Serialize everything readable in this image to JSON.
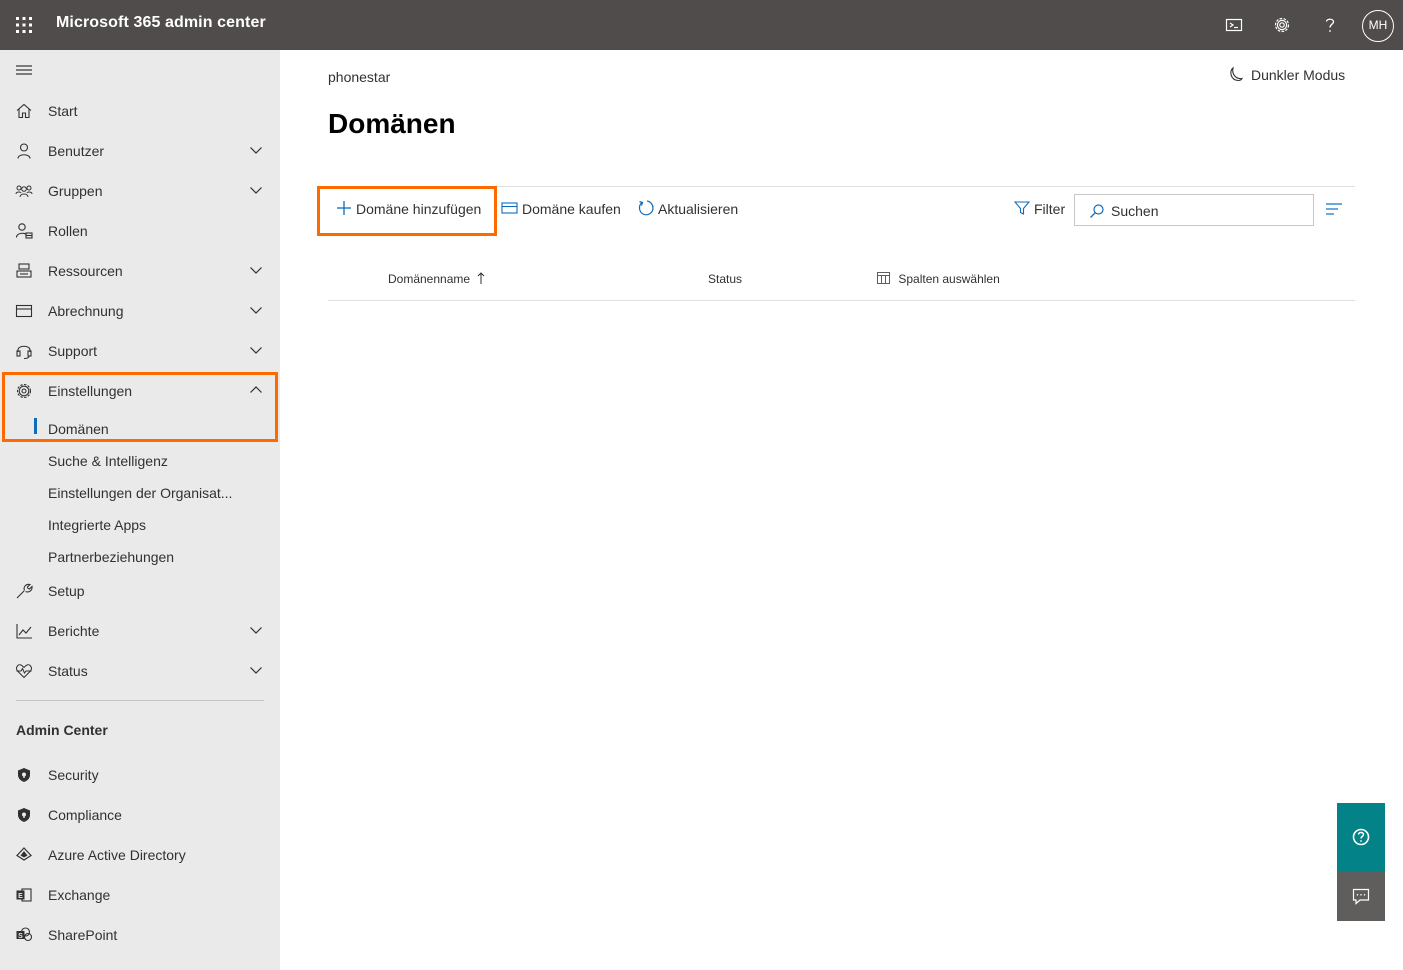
{
  "header": {
    "app_title": "Microsoft 365 admin center",
    "avatar_initials": "MH",
    "icons": [
      "waffle-icon",
      "terminal-icon",
      "gear-icon",
      "help-icon"
    ]
  },
  "sidebar": {
    "items": [
      {
        "label": "Start",
        "icon": "home-icon"
      },
      {
        "label": "Benutzer",
        "icon": "user-icon"
      },
      {
        "label": "Gruppen",
        "icon": "group-icon"
      },
      {
        "label": "Rollen",
        "icon": "roles-icon"
      },
      {
        "label": "Ressourcen",
        "icon": "resources-icon"
      },
      {
        "label": "Abrechnung",
        "icon": "billing-icon"
      },
      {
        "label": "Support",
        "icon": "headset-icon"
      },
      {
        "label": "Einstellungen",
        "icon": "gear-icon"
      },
      {
        "label": "Setup",
        "icon": "wrench-icon"
      },
      {
        "label": "Berichte",
        "icon": "chart-icon"
      },
      {
        "label": "Status",
        "icon": "heart-pulse-icon"
      }
    ],
    "settings_subitems": [
      {
        "label": "Domänen",
        "selected": true
      },
      {
        "label": "Suche & Intelligenz"
      },
      {
        "label": "Einstellungen der Organisat..."
      },
      {
        "label": "Integrierte Apps"
      },
      {
        "label": "Partnerbeziehungen"
      }
    ],
    "admin_centers_title": "Admin Center",
    "admin_centers": [
      {
        "label": "Security",
        "icon": "shield-icon"
      },
      {
        "label": "Compliance",
        "icon": "shield-icon"
      },
      {
        "label": "Azure Active Directory",
        "icon": "azure-ad-icon"
      },
      {
        "label": "Exchange",
        "icon": "exchange-icon"
      },
      {
        "label": "SharePoint",
        "icon": "sharepoint-icon"
      }
    ]
  },
  "main": {
    "tenant": "phonestar",
    "dark_mode_label": "Dunkler Modus",
    "page_title": "Domänen",
    "commands": {
      "add": "Domäne hinzufügen",
      "buy": "Domäne kaufen",
      "refresh": "Aktualisieren",
      "filter": "Filter"
    },
    "search": {
      "placeholder": "Suchen"
    },
    "table": {
      "columns": [
        "Domänenname",
        "Status",
        "Spalten auswählen"
      ],
      "sort_column": "Domänenname",
      "rows": []
    }
  },
  "colors": {
    "topbar": "#4f4c4b",
    "sidebar": "#eaeaea",
    "accent": "#0f6cbd",
    "highlight": "#ff6a00",
    "help_fab": "#038387",
    "feedback_fab": "#605e5c"
  }
}
